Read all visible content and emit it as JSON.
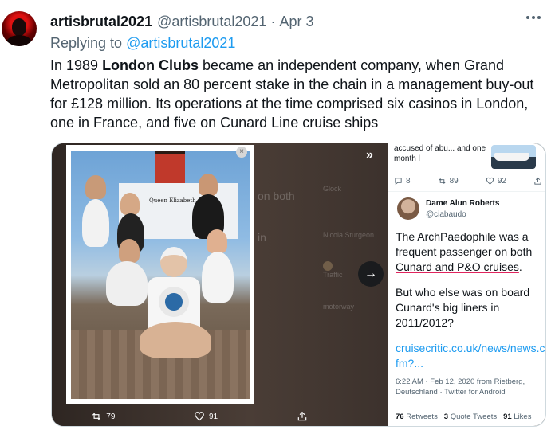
{
  "tweet": {
    "display_name": "artisbrutal2021",
    "handle": "@artisbrutal2021",
    "separator": "·",
    "date": "Apr 3",
    "reply_prefix": "Replying to",
    "reply_handle": "@artisbrutal2021",
    "text_before": "In 1989 ",
    "text_bold": "London Clubs",
    "text_after": " became an independent company, when Grand Metropolitan sold an 80 percent stake in the chain in a management buy-out for £128 million. Its operations at the time comprised six casinos in London, one in France, and five on Cunard Line cruise ships"
  },
  "media": {
    "ship_name": "Queen Elizabeth",
    "next_chevron": "»",
    "next_arrow": "→",
    "close_glyph": "×",
    "actions": {
      "retweet_count": "79",
      "like_count": "91"
    },
    "bg_fragments": [
      "on both",
      "in",
      "Glock",
      "Nicola Sturgeon",
      "Traffic",
      "motorway"
    ],
    "embedded_tweet": {
      "top_text": "accused of abu... and one month l",
      "reply_count": "8",
      "retweet_count": "89",
      "like_count": "92",
      "author_name": "Dame Alun Roberts",
      "author_handle": "@ciabaudo",
      "text_line1": "The ArchPaedophile was a frequent passenger on both ",
      "text_underlined": "Cunard and P&O cruises",
      "text_line1_end": ".",
      "text_line2": "But who else was on board Cunard's big liners in 2011/2012?",
      "link": "cruisecritic.co.uk/news/news.cfm?...",
      "meta": "6:22 AM · Feb 12, 2020 from Rietberg, Deutschland · Twitter for Android",
      "retweets": "76",
      "retweets_label": "Retweets",
      "quotes": "3",
      "quotes_label": "Quote Tweets",
      "likes": "91",
      "likes_label": "Likes"
    }
  },
  "colors": {
    "accent": "#1d9bf0",
    "text": "#0f1419",
    "muted": "#536471",
    "underline": "#e0245e"
  }
}
